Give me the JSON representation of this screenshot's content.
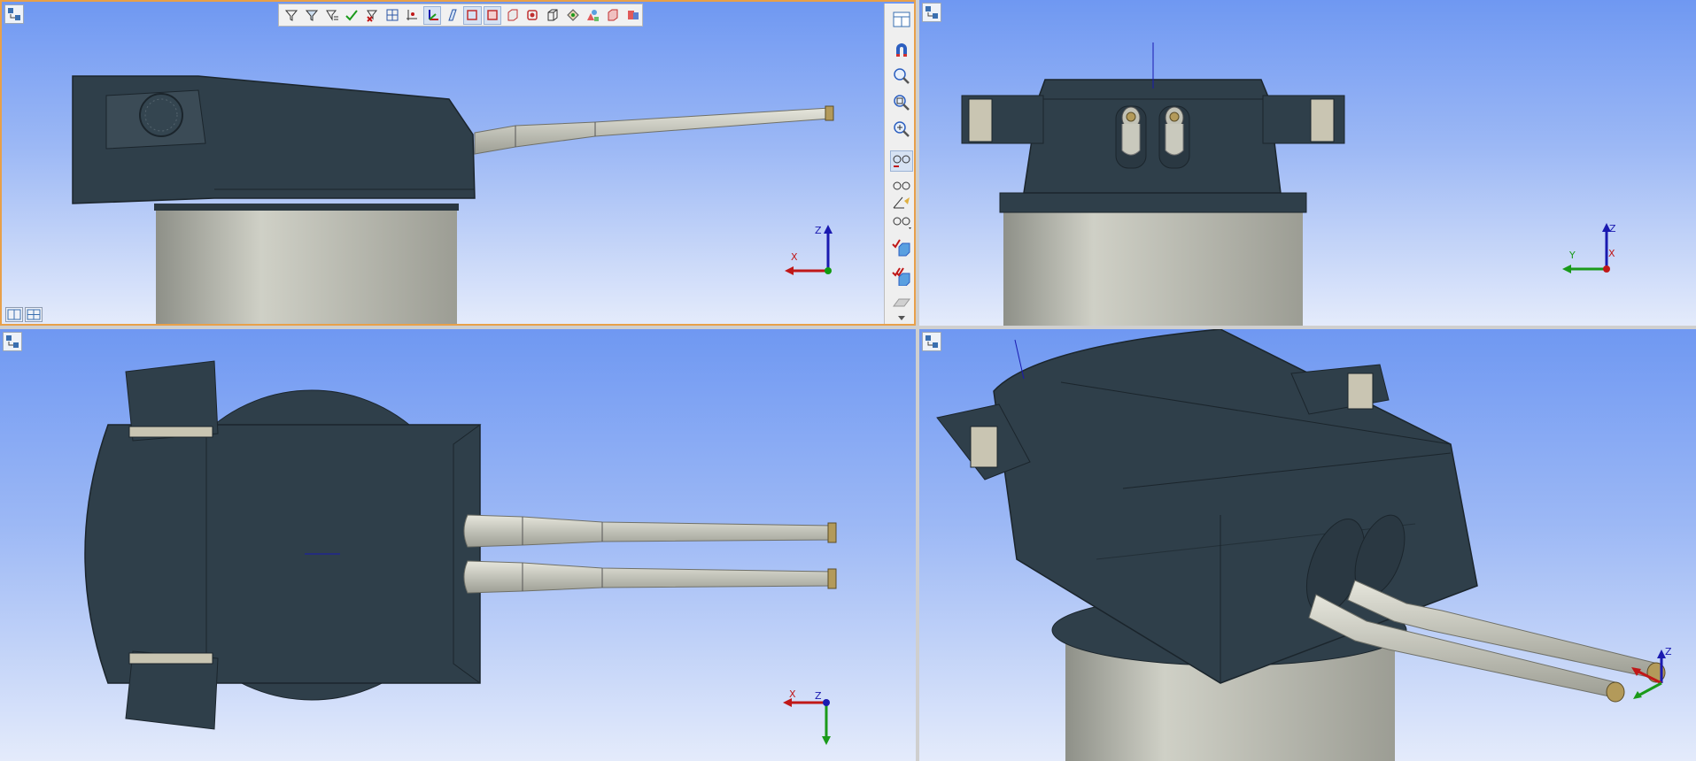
{
  "app": {
    "accent_color": "#e8a04a",
    "background_top": "#6f98f2",
    "background_bottom": "#e4ebfb",
    "model_color": "#2f3f4a",
    "barrel_color": "#c9c9bd"
  },
  "views": [
    {
      "name": "side-view",
      "axes": {
        "up": "Z",
        "left": "X"
      }
    },
    {
      "name": "front-view",
      "axes": {
        "up": "Z",
        "left": "Y",
        "right": "X"
      }
    },
    {
      "name": "top-view",
      "axes": {
        "up": "Z",
        "left": "X"
      }
    },
    {
      "name": "isometric-view",
      "axes": {
        "up": "Z",
        "left": "Y",
        "right": "X"
      }
    }
  ],
  "toolbar_top": {
    "icons": [
      "filter-icon",
      "filter-sketch-icon",
      "filter-list-icon",
      "check-icon",
      "uncheck-icon",
      "grid-icon",
      "origin-point-icon",
      "axes-icon",
      "plane-icon",
      "wireframe-icon",
      "hidden-lines-icon",
      "shaded-icon",
      "shaded-edges-icon",
      "box-icon",
      "section-icon",
      "shapes-icon",
      "material-icon",
      "render-icon"
    ]
  },
  "toolbar_side": {
    "icons": [
      "view-orient-icon",
      "magnet-icon",
      "zoom-icon",
      "zoom-area-icon",
      "zoom-fit-icon",
      "glasses-select-icon",
      "glasses-hide-icon",
      "measure-icon",
      "glasses-icon",
      "check-box-icon",
      "double-check-box-icon",
      "plane-gray-icon",
      "more-icon"
    ]
  }
}
